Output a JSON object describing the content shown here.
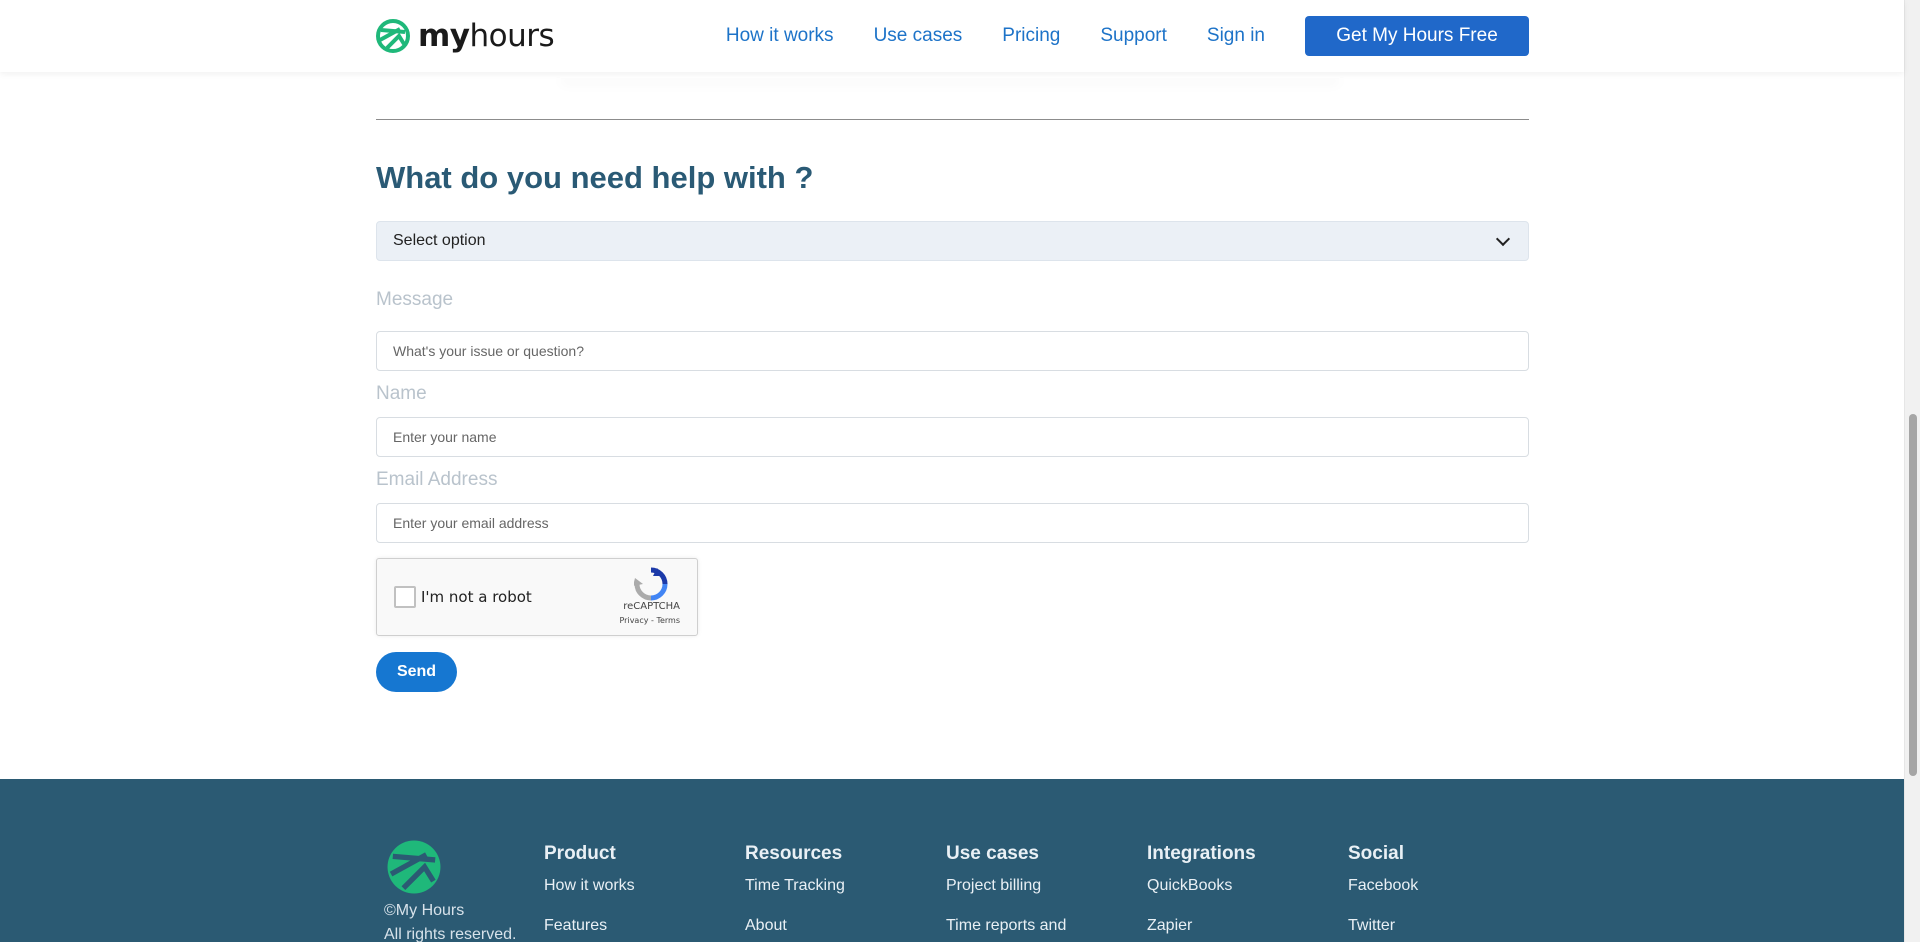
{
  "brand": {
    "name_bold": "my",
    "name_light": "hours",
    "accent": "#1fb87a"
  },
  "nav": {
    "items": [
      "How it works",
      "Use cases",
      "Pricing",
      "Support",
      "Sign in"
    ],
    "cta": "Get My Hours Free"
  },
  "form": {
    "title": "What do you need help with ?",
    "select_value": "Select option",
    "message_label": "Message",
    "message_placeholder": "What's your issue or question?",
    "name_label": "Name",
    "name_placeholder": "Enter your name",
    "email_label": "Email Address",
    "email_placeholder": "Enter your email address",
    "captcha": {
      "label": "I'm not a robot",
      "brand": "reCAPTCHA",
      "links": "Privacy - Terms"
    },
    "submit": "Send"
  },
  "footer": {
    "copyright": "©My Hours",
    "rights": "All rights reserved.",
    "columns": [
      {
        "title": "Product",
        "links": [
          "How it works",
          "Features"
        ]
      },
      {
        "title": "Resources",
        "links": [
          "Time Tracking",
          "About"
        ]
      },
      {
        "title": "Use cases",
        "links": [
          "Project billing",
          "Time reports and"
        ]
      },
      {
        "title": "Integrations",
        "links": [
          "QuickBooks",
          "Zapier"
        ]
      },
      {
        "title": "Social",
        "links": [
          "Facebook",
          "Twitter"
        ]
      }
    ]
  }
}
